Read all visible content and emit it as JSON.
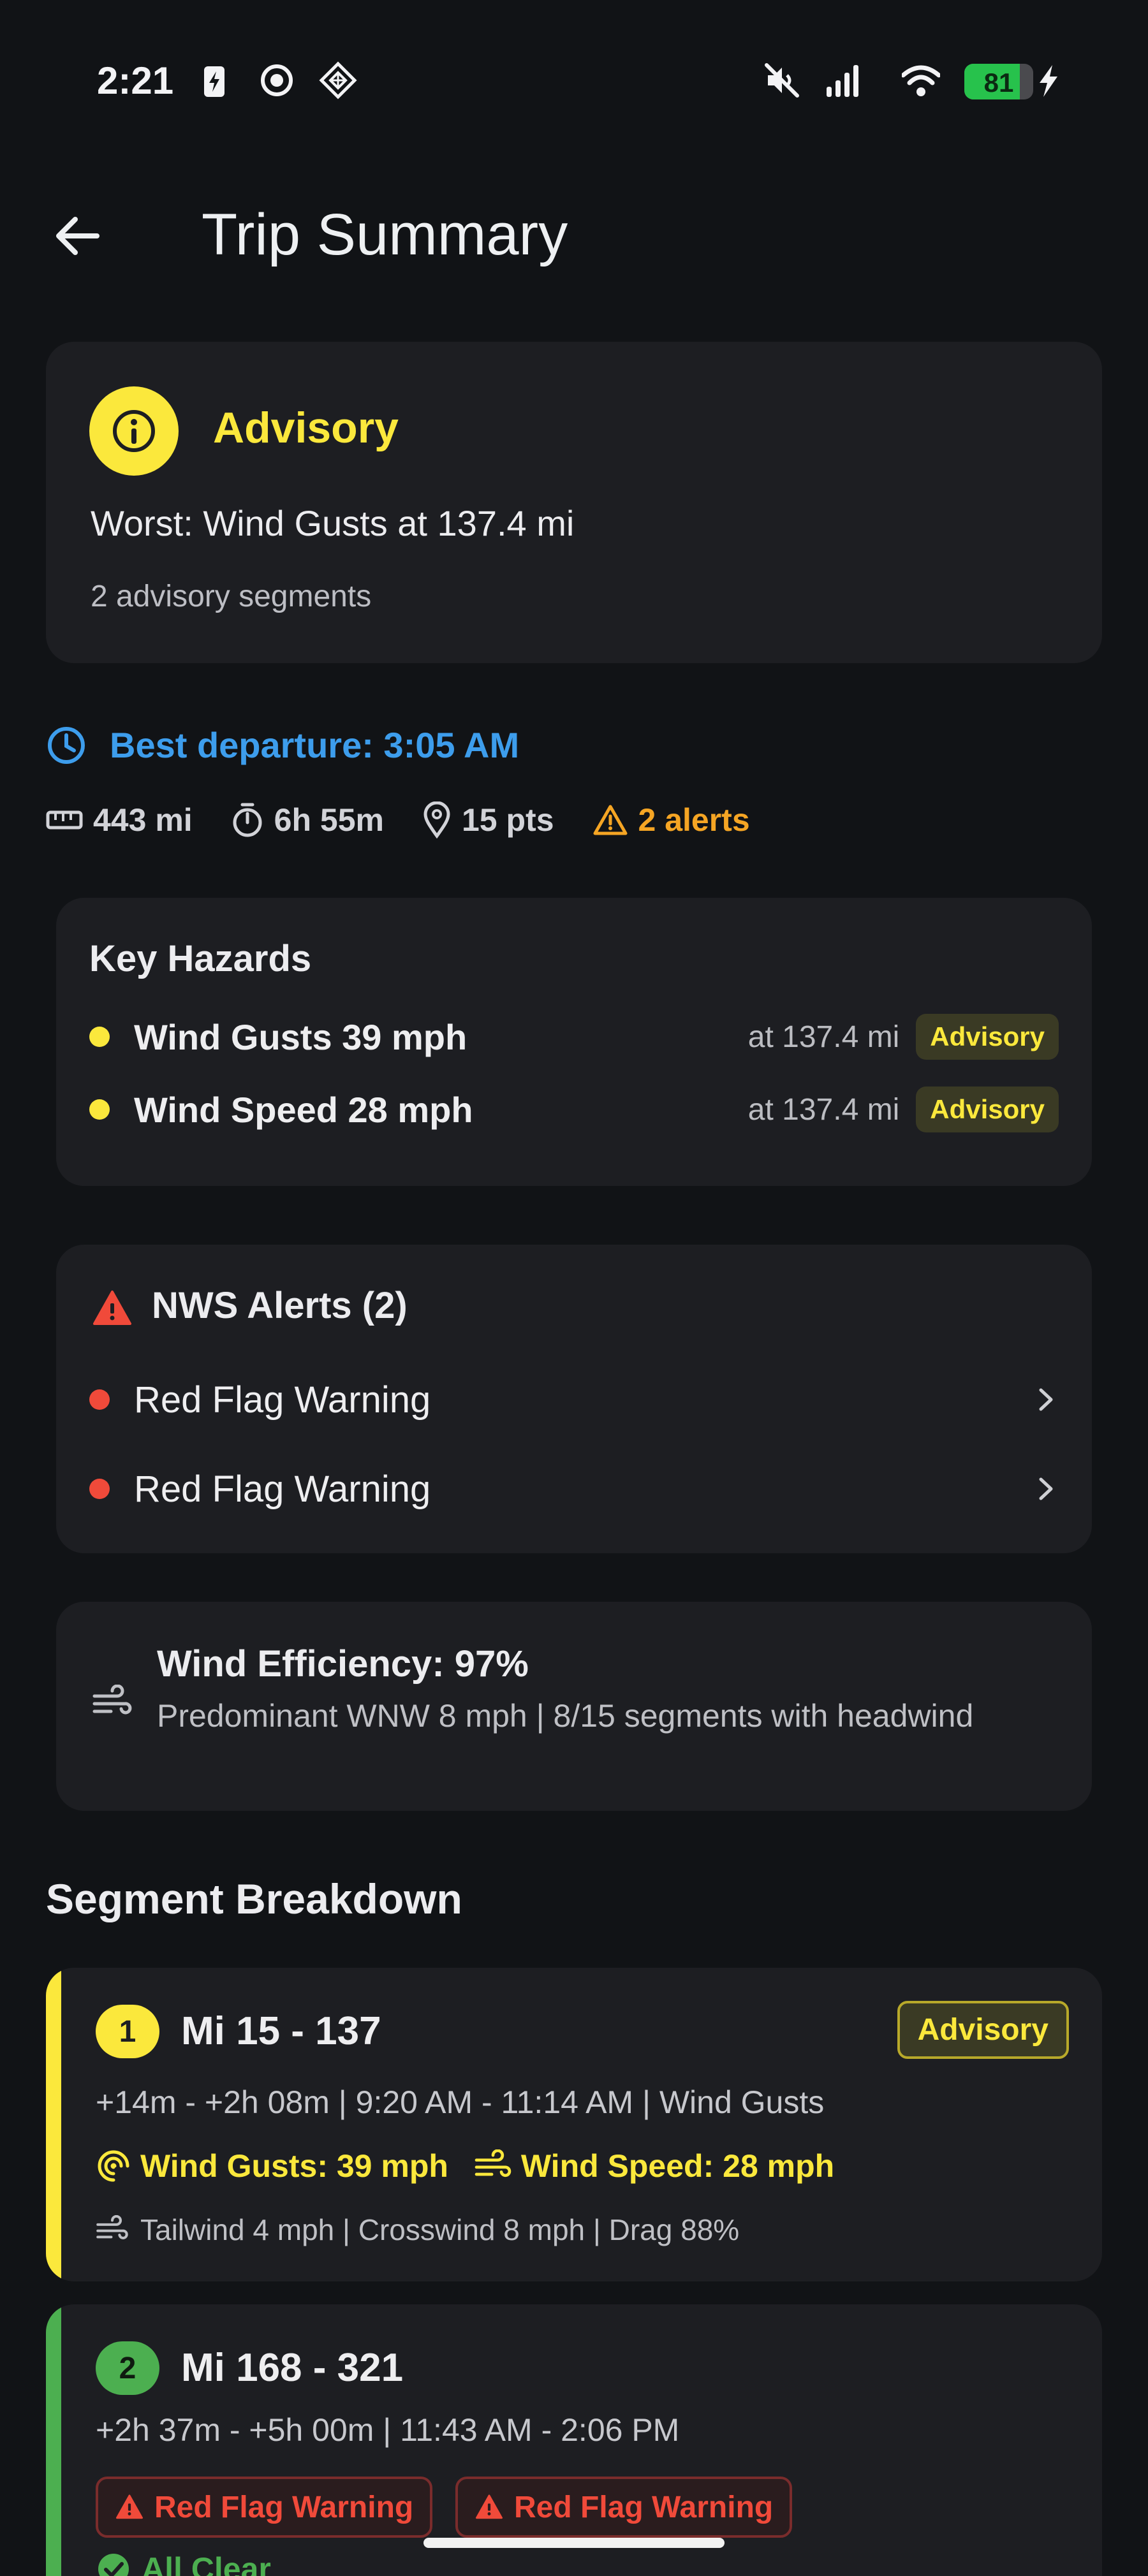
{
  "status_bar": {
    "time": "2:21",
    "battery": "81",
    "battery_level_percent": 81,
    "left_icons": [
      "charging-bolt-icon",
      "record-icon",
      "diamond-grid-icon"
    ],
    "right_icons": [
      "mute-icon",
      "signal-icon",
      "wifi-icon",
      "battery-icon",
      "charging-icon"
    ]
  },
  "app_bar": {
    "title": "Trip Summary",
    "back_icon": "arrow-left-icon"
  },
  "advisory": {
    "title": "Advisory",
    "worst": "Worst: Wind Gusts at 137.4 mi",
    "segments": "2 advisory segments",
    "color": "#fbe83c"
  },
  "best_departure": "Best departure: 3:05 AM",
  "stats": {
    "distance": "443 mi",
    "duration": "6h 55m",
    "points": "15 pts",
    "alerts": "2 alerts"
  },
  "key_hazards": {
    "title": "Key Hazards",
    "items": [
      {
        "name": "Wind Gusts 39 mph",
        "at": "at 137.4 mi",
        "badge": "Advisory"
      },
      {
        "name": "Wind Speed 28 mph",
        "at": "at 137.4 mi",
        "badge": "Advisory"
      }
    ]
  },
  "nws_alerts": {
    "title": "NWS Alerts (2)",
    "items": [
      {
        "name": "Red Flag Warning"
      },
      {
        "name": "Red Flag Warning"
      }
    ]
  },
  "wind_efficiency": {
    "title": "Wind Efficiency: 97%",
    "detail": "Predominant WNW 8 mph  |  8/15 segments with headwind"
  },
  "segment_breakdown": {
    "title": "Segment Breakdown",
    "segments": [
      {
        "number": "1",
        "range": "Mi 15 - 137",
        "status": "Advisory",
        "meta": "+14m - +2h 08m  |  9:20 AM - 11:14 AM  |  Wind Gusts",
        "hazards": [
          "Wind Gusts: 39 mph",
          "Wind Speed: 28 mph"
        ],
        "wind": "Tailwind 4 mph  |  Crosswind 8 mph  |  Drag 88%",
        "accent": "#fbe83c"
      },
      {
        "number": "2",
        "range": "Mi 168 - 321",
        "meta": "+2h 37m - +5h 00m  |  11:43 AM - 2:06 PM",
        "alerts": [
          "Red Flag Warning",
          "Red Flag Warning"
        ],
        "clear": "All Clear",
        "accent": "#4caf50"
      }
    ]
  }
}
